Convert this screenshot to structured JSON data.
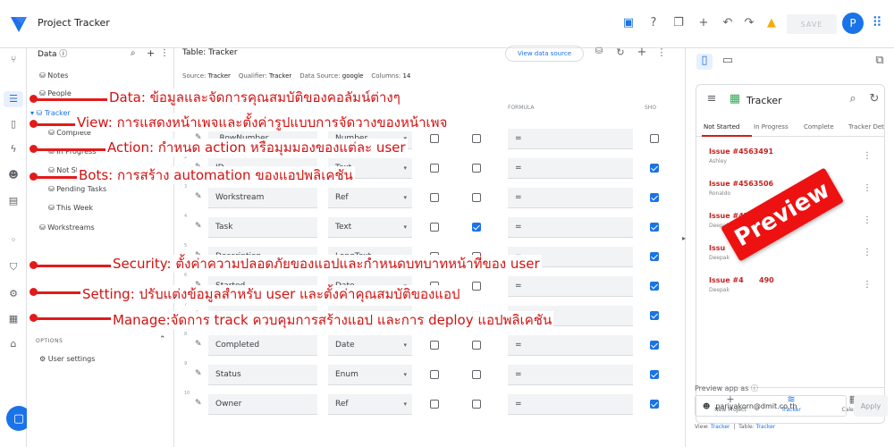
{
  "app": {
    "title": "Project Tracker",
    "save_label": "SAVE",
    "avatar_letter": "P"
  },
  "data_panel": {
    "header": "Data ⓘ",
    "tables": [
      {
        "label": "Notes"
      },
      {
        "label": "People"
      },
      {
        "label": "Tracker"
      }
    ],
    "tracker_views": [
      "Complete",
      "In Progress",
      "Not Started",
      "Pending Tasks",
      "This Week"
    ],
    "workstreams_label": "Workstreams",
    "options_label": "OPTIONS",
    "user_settings_label": "User settings"
  },
  "main": {
    "title": "Table: Tracker",
    "view_data_source": "View data source",
    "meta": {
      "source_label": "Source:",
      "source": "Tracker",
      "qualifier_label": "Qualifier:",
      "qualifier": "Tracker",
      "datasource_label": "Data Source:",
      "datasource": "google",
      "columns_label": "Columns:",
      "columns": "14"
    },
    "headers": {
      "formula": "FORMULA",
      "show": "SHO"
    },
    "rows": [
      {
        "num": "1",
        "name": "_RowNumber",
        "type": "Number",
        "c1": false,
        "c2": false,
        "formula": "=",
        "show": false
      },
      {
        "num": "2",
        "name": "ID",
        "type": "Text",
        "c1": false,
        "c2": false,
        "formula": "=",
        "show": true
      },
      {
        "num": "3",
        "name": "Workstream",
        "type": "Ref",
        "c1": false,
        "c2": false,
        "formula": "=",
        "show": true
      },
      {
        "num": "4",
        "name": "Task",
        "type": "Text",
        "c1": false,
        "c2": true,
        "formula": "=",
        "show": true
      },
      {
        "num": "5",
        "name": "Description",
        "type": "LongText",
        "c1": false,
        "c2": false,
        "formula": "=",
        "show": true
      },
      {
        "num": "6",
        "name": "Started",
        "type": "Date",
        "c1": false,
        "c2": false,
        "formula": "=",
        "show": true
      },
      {
        "num": "7",
        "name": "Due",
        "type": "Date",
        "c1": false,
        "c2": false,
        "formula": "=",
        "show": true
      },
      {
        "num": "8",
        "name": "Completed",
        "type": "Date",
        "c1": false,
        "c2": false,
        "formula": "=",
        "show": true
      },
      {
        "num": "9",
        "name": "Status",
        "type": "Enum",
        "c1": false,
        "c2": false,
        "formula": "=",
        "show": true
      },
      {
        "num": "10",
        "name": "Owner",
        "type": "Ref",
        "c1": false,
        "c2": false,
        "formula": "=",
        "show": true
      }
    ]
  },
  "preview": {
    "app_name": "Tracker",
    "tabs": [
      "Not Started",
      "In Progress",
      "Complete",
      "Tracker Deta"
    ],
    "issues": [
      {
        "id": "Issue #4563491",
        "owner": "Ashley"
      },
      {
        "id": "Issue #4563506",
        "owner": "Ronaldo"
      },
      {
        "id": "Issue #4563507",
        "owner": "Deepak"
      },
      {
        "id": "Issu",
        "owner": "Deepak"
      },
      {
        "id": "Issue #4",
        "id_tail": "490",
        "owner": "Deepak"
      }
    ],
    "bottom_nav": [
      "New Project",
      "Tracker",
      "Calendar"
    ],
    "preview_as_label": "Preview app as ⓘ",
    "email": "pariyakorn@dmit.co.th",
    "apply": "Apply",
    "footer": {
      "view_label": "View:",
      "view": "Tracker",
      "table_label": "Table:",
      "table": "Tracker"
    }
  },
  "annotations": {
    "data": "Data: ข้อมูลและจัดการคุณสมบัติของคอลัมน์ต่างๆ",
    "view": "View: การแสดงหน้าเพจและตั้งค่ารูปแบบการจัดวางของหน้าเพจ",
    "action": "Action: กำหนด action หรือมุมมองของแต่ละ user",
    "bots": "Bots: การสร้าง automation ของแอปพลิเคชัน",
    "security": "Security: ตั้งค่าความปลอดภัยของแอปและกำหนดบทบาทหน้าที่ของ user",
    "setting": "Setting: ปรับแต่งข้อมูลสำหรับ user และตั้งค่าคุณสมบัติของแอป",
    "manage": "Manage:จัดการ track ควบคุมการสร้างแอป และการ deploy แอปพลิเคชัน",
    "preview_badge": "Preview"
  },
  "colors": {
    "accent": "#1a73e8",
    "annotation_red": "#e31a1a",
    "issue_red": "#c5221f"
  }
}
